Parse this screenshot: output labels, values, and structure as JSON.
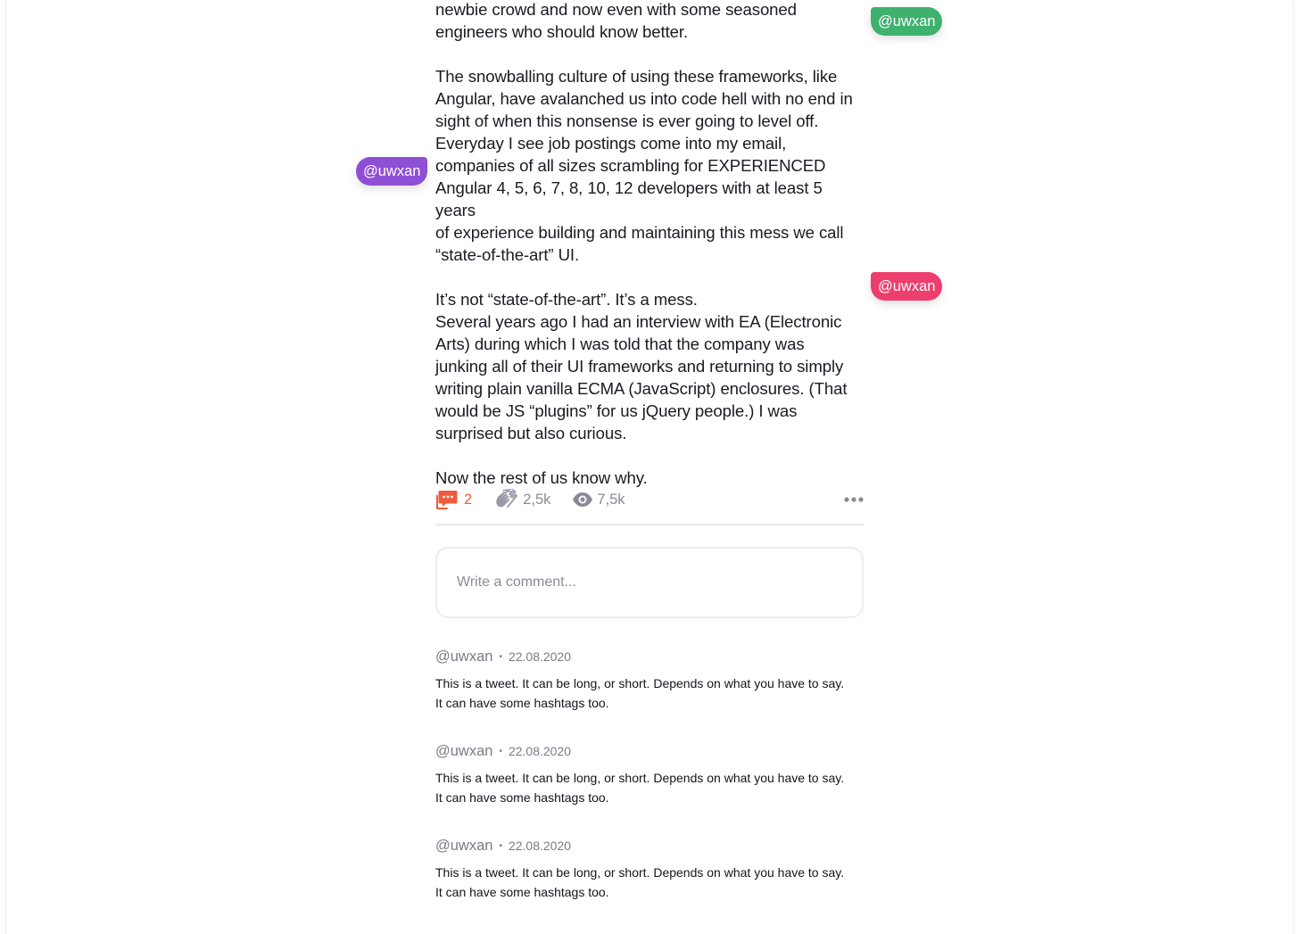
{
  "article": {
    "paragraphs": [
      "newbie crowd and now even with some seasoned\nengineers who should know better.",
      "The snowballing culture of using these frameworks, like\nAngular, have avalanched us into code hell with no end in\nsight of when this nonsense is ever going to level off.\nEveryday I see job postings come into my email,\ncompanies of all sizes scrambling for EXPERIENCED\nAngular 4, 5, 6, 7, 8, 10, 12 developers with at least 5 years\nof experience building and maintaining this mess we call\n“state-of-the-art” UI.",
      "It’s not “state-of-the-art”. It’s a mess.\nSeveral years ago I had an interview with EA (Electronic\nArts) during which I was told that the company was\njunking all of their UI frameworks and returning to simply\nwriting plain vanilla ECMA (JavaScript) enclosures. (That\nwould be JS “plugins” for us jQuery people.) I was\nsurprised but also curious.",
      "Now the rest of us know why."
    ]
  },
  "tags": [
    {
      "label": "@uwxan",
      "color": "#3fb16f"
    },
    {
      "label": "@uwxan",
      "color": "#8e4fd4"
    },
    {
      "label": "@uwxan",
      "color": "#ec3f6e"
    }
  ],
  "actions": {
    "comments_count": "2",
    "claps_count": "2,5k",
    "views_count": "7,5k",
    "comments_icon": "comments-icon",
    "claps_icon": "clap-icon",
    "views_icon": "eye-icon",
    "more_icon": "more-dots-icon",
    "accent_color": "#ef5c3c"
  },
  "comment_input": {
    "placeholder": "Write a comment..."
  },
  "comments": [
    {
      "author": "@uwxan",
      "separator": "•",
      "date": "22.08.2020",
      "text": "This is a tweet. It can be long, or short. Depends on what you have to say.\nIt can have some hashtags too."
    },
    {
      "author": "@uwxan",
      "separator": "•",
      "date": "22.08.2020",
      "text": "This is a tweet. It can be long, or short. Depends on what you have to say.\nIt can have some hashtags too."
    },
    {
      "author": "@uwxan",
      "separator": "•",
      "date": "22.08.2020",
      "text": "This is a tweet. It can be long, or short. Depends on what you have to say.\nIt can have some hashtags too."
    }
  ]
}
